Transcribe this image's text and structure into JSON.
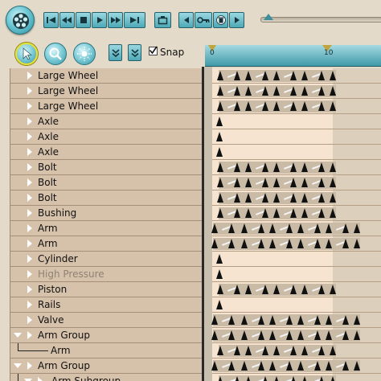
{
  "toolbar": {
    "app_icon": "film-reel-icon",
    "transport": [
      {
        "name": "go-to-start-button",
        "icon": "skip-back-icon"
      },
      {
        "name": "rewind-button",
        "icon": "rewind-icon"
      },
      {
        "name": "stop-button",
        "icon": "stop-icon"
      },
      {
        "name": "play-button",
        "icon": "play-icon"
      },
      {
        "name": "fast-forward-button",
        "icon": "fast-forward-icon"
      },
      {
        "name": "go-to-end-button",
        "icon": "skip-forward-icon"
      }
    ],
    "loop_icon": "loop-icon",
    "key_tools": [
      {
        "name": "previous-key-button",
        "icon": "arrow-left-icon"
      },
      {
        "name": "set-key-button",
        "icon": "key-icon"
      },
      {
        "name": "delete-key-button",
        "icon": "trash-icon"
      },
      {
        "name": "next-key-button",
        "icon": "arrow-right-icon"
      }
    ],
    "scrub_position": 0.03
  },
  "tools": {
    "select_icon": "arrow-cursor-icon",
    "zoom_icon": "magnifier-icon",
    "pan_icon": "sun-icon",
    "collapse_icon": "double-chevron-down-icon",
    "expand_icon": "double-chevron-down-icon",
    "snap_label": "Snap",
    "snap_checked": true
  },
  "timeline": {
    "start_label": "0",
    "end_label": "10"
  },
  "tracks": [
    {
      "label": "Large Wheel",
      "kind": "full"
    },
    {
      "label": "Large Wheel",
      "kind": "full"
    },
    {
      "label": "Large Wheel",
      "kind": "full"
    },
    {
      "label": "Axle",
      "kind": "single"
    },
    {
      "label": "Axle",
      "kind": "single"
    },
    {
      "label": "Axle",
      "kind": "single"
    },
    {
      "label": "Bolt",
      "kind": "full"
    },
    {
      "label": "Bolt",
      "kind": "full"
    },
    {
      "label": "Bolt",
      "kind": "full"
    },
    {
      "label": "Bushing",
      "kind": "full"
    },
    {
      "label": "Arm",
      "kind": "long"
    },
    {
      "label": "Arm",
      "kind": "long"
    },
    {
      "label": "Cylinder",
      "kind": "single"
    },
    {
      "label": "High Pressure",
      "kind": "single",
      "disabled": true
    },
    {
      "label": "Piston",
      "kind": "full"
    },
    {
      "label": "Rails",
      "kind": "single"
    },
    {
      "label": "Valve",
      "kind": "long"
    },
    {
      "label": "Arm Group",
      "kind": "long",
      "group": true
    },
    {
      "label": "Arm",
      "kind": "full",
      "child": true
    },
    {
      "label": "Arm Group",
      "kind": "long",
      "group": true
    },
    {
      "label": "Arm Subgroup",
      "kind": "full",
      "subgroup": true
    }
  ]
}
